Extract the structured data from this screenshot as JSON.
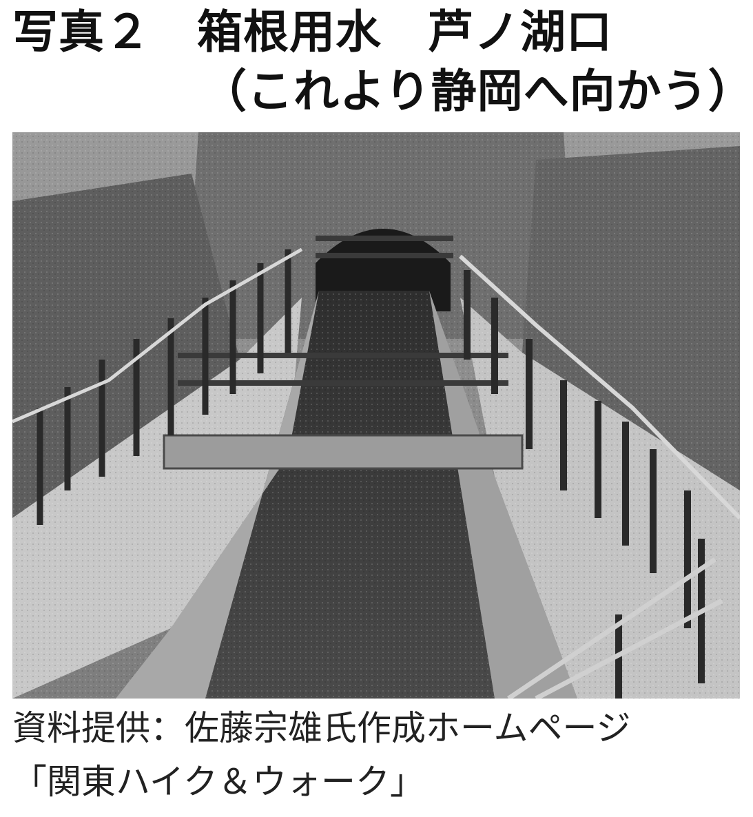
{
  "title": {
    "line1": "写真２　箱根用水　芦ノ湖口",
    "line2": "（これより静岡へ向かう）"
  },
  "photo": {
    "subject": "hakone-canal-tunnel-inlet",
    "tone": "grayscale"
  },
  "caption": {
    "line1": "資料提供：佐藤宗雄氏作成ホームページ",
    "line2": "「関東ハイク＆ウォーク」"
  }
}
